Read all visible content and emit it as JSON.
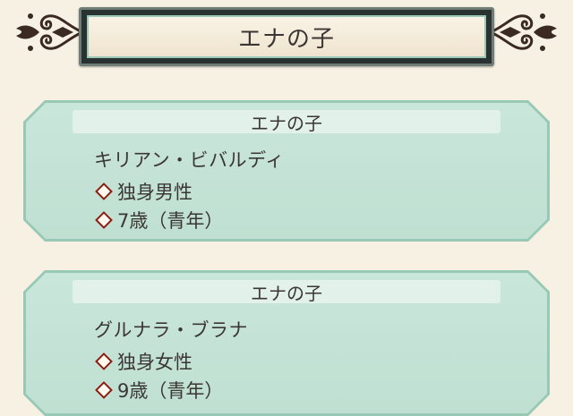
{
  "header": {
    "title": "エナの子"
  },
  "children": [
    {
      "label": "エナの子",
      "name": "キリアン・ビバルディ",
      "status": "独身男性",
      "age": "7歳（青年）"
    },
    {
      "label": "エナの子",
      "name": "グルナラ・ブラナ",
      "status": "独身女性",
      "age": "9歳（青年）"
    }
  ],
  "colors": {
    "background": "#f7f1e4",
    "card_border": "#98c9b5",
    "card_fill": "#c9e6da",
    "bullet": "#8a1d12",
    "header_frame": "#2a3131"
  },
  "icons": [
    "left-scroll-ornament-icon",
    "right-scroll-ornament-icon",
    "diamond-bullet-icon"
  ]
}
